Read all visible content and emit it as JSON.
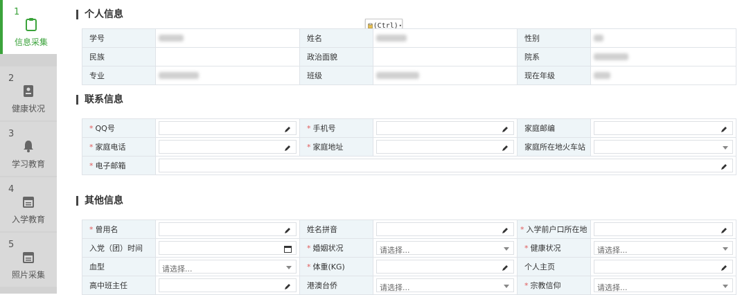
{
  "sidebar": {
    "steps": [
      {
        "num": "1",
        "label": "信息采集"
      },
      {
        "num": "2",
        "label": "健康状况"
      },
      {
        "num": "3",
        "label": "学习教育"
      },
      {
        "num": "4",
        "label": "入学教育"
      },
      {
        "num": "5",
        "label": "照片采集"
      }
    ]
  },
  "paste_button": {
    "label": "(Ctrl)"
  },
  "personal": {
    "title": "个人信息",
    "fields": {
      "student_id": "学号",
      "name": "姓名",
      "gender": "性别",
      "ethnicity": "民族",
      "political": "政治面貌",
      "department": "院系",
      "major": "专业",
      "class": "班级",
      "grade": "现在年级"
    }
  },
  "contact": {
    "title": "联系信息",
    "fields": {
      "qq": "QQ号",
      "mobile": "手机号",
      "postcode": "家庭邮编",
      "home_phone": "家庭电话",
      "home_address": "家庭地址",
      "station": "家庭所在地火车站",
      "email": "电子邮箱"
    }
  },
  "other": {
    "title": "其他信息",
    "placeholder": "请选择...",
    "fields": {
      "former_name": "曾用名",
      "pinyin": "姓名拼音",
      "hukou": "入学前户口所在地",
      "party_date": "入党（团）时间",
      "marital": "婚姻状况",
      "health": "健康状况",
      "blood": "血型",
      "weight": "体重(KG)",
      "homepage": "个人主页",
      "teacher": "高中班主任",
      "hmt": "港澳台侨",
      "religion": "宗教信仰"
    }
  }
}
